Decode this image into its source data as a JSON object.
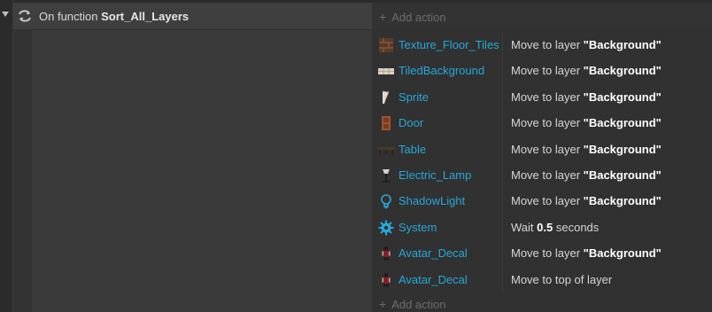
{
  "event": {
    "prefix": "On function",
    "function_name": "Sort_All_Layers",
    "add_action_label": "Add action"
  },
  "actions": [
    {
      "object": "Texture_Floor_Tiles",
      "icon": "floor-tiles-icon",
      "action_prefix": "Move to layer",
      "action_value": "\"Background\"",
      "action_suffix": ""
    },
    {
      "object": "TiledBackground",
      "icon": "tiled-background-icon",
      "action_prefix": "Move to layer",
      "action_value": "\"Background\"",
      "action_suffix": ""
    },
    {
      "object": "Sprite",
      "icon": "sprite-icon",
      "action_prefix": "Move to layer",
      "action_value": "\"Background\"",
      "action_suffix": ""
    },
    {
      "object": "Door",
      "icon": "door-icon",
      "action_prefix": "Move to layer",
      "action_value": "\"Background\"",
      "action_suffix": ""
    },
    {
      "object": "Table",
      "icon": "table-icon",
      "action_prefix": "Move to layer",
      "action_value": "\"Background\"",
      "action_suffix": ""
    },
    {
      "object": "Electric_Lamp",
      "icon": "lamp-icon",
      "action_prefix": "Move to layer",
      "action_value": "\"Background\"",
      "action_suffix": ""
    },
    {
      "object": "ShadowLight",
      "icon": "lightbulb-icon",
      "action_prefix": "Move to layer",
      "action_value": "\"Background\"",
      "action_suffix": ""
    },
    {
      "object": "System",
      "icon": "gear-icon",
      "action_prefix": "Wait",
      "action_value": "0.5",
      "action_suffix": "seconds"
    },
    {
      "object": "Avatar_Decal",
      "icon": "avatar-icon",
      "action_prefix": "Move to layer",
      "action_value": "\"Background\"",
      "action_suffix": ""
    },
    {
      "object": "Avatar_Decal",
      "icon": "avatar-icon",
      "action_prefix": "Move to top of layer",
      "action_value": "",
      "action_suffix": ""
    }
  ],
  "colors": {
    "object_name": "#26a8d8",
    "background": "#2b2b2b",
    "header": "#3f3f3f"
  }
}
